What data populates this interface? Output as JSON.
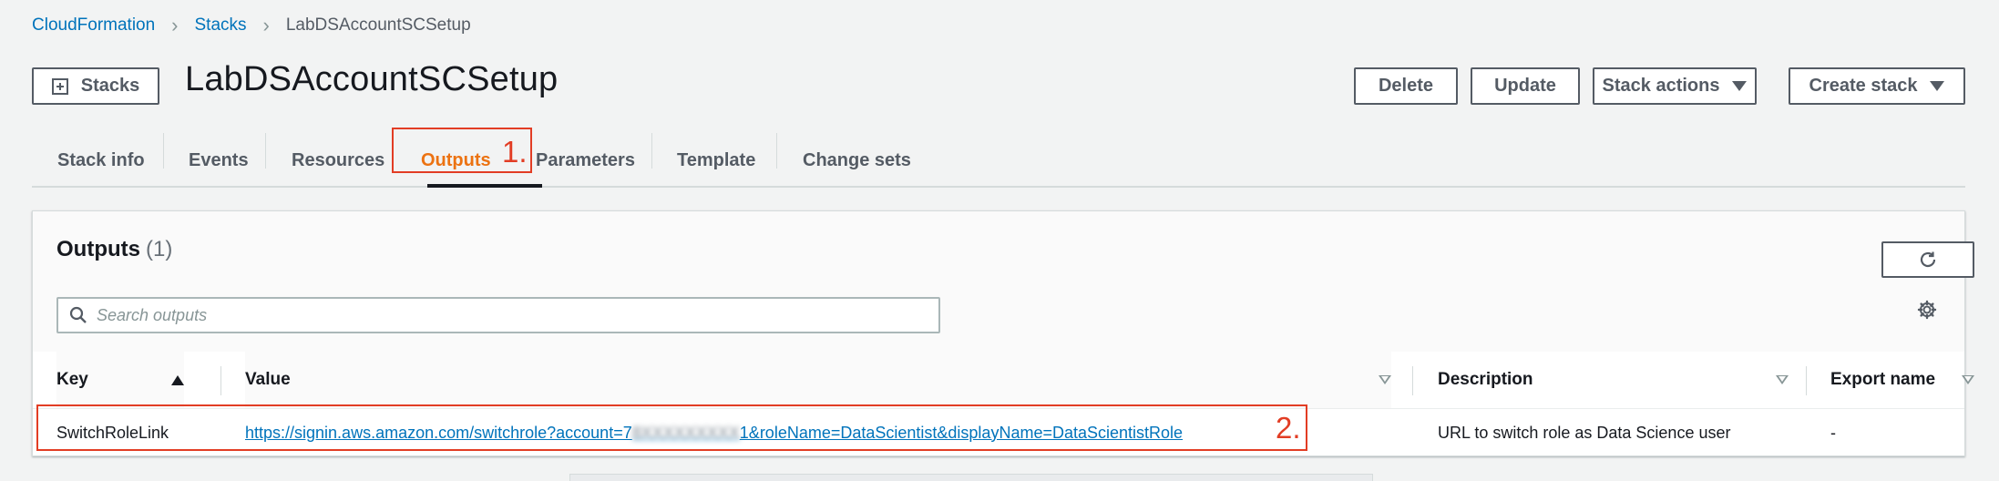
{
  "breadcrumb": {
    "items": [
      "CloudFormation",
      "Stacks",
      "LabDSAccountSCSetup"
    ]
  },
  "header": {
    "back_button_label": "Stacks",
    "title": "LabDSAccountSCSetup",
    "actions": {
      "delete": "Delete",
      "update": "Update",
      "stack_actions": "Stack actions",
      "create_stack": "Create stack"
    }
  },
  "tabs": [
    "Stack info",
    "Events",
    "Resources",
    "Outputs",
    "Parameters",
    "Template",
    "Change sets"
  ],
  "active_tab": "Outputs",
  "annotations": [
    "1.",
    "2."
  ],
  "outputs": {
    "title": "Outputs",
    "count": "(1)",
    "search_placeholder": "Search outputs",
    "columns": [
      "Key",
      "Value",
      "Description",
      "Export name"
    ],
    "rows": [
      {
        "key": "SwitchRoleLink",
        "value_prefix": "https://signin.aws.amazon.com/switchrole?account=7",
        "value_redacted": "8XXXXXXXXX",
        "value_suffix": "1&roleName=DataScientist&displayName=DataScientistRole",
        "description": "URL to switch role as Data Science user",
        "export_name": "-"
      }
    ]
  },
  "colors": {
    "link": "#0073bb",
    "active_tab": "#ec7211",
    "annotation": "#e23d24",
    "button_border": "#545b64"
  }
}
